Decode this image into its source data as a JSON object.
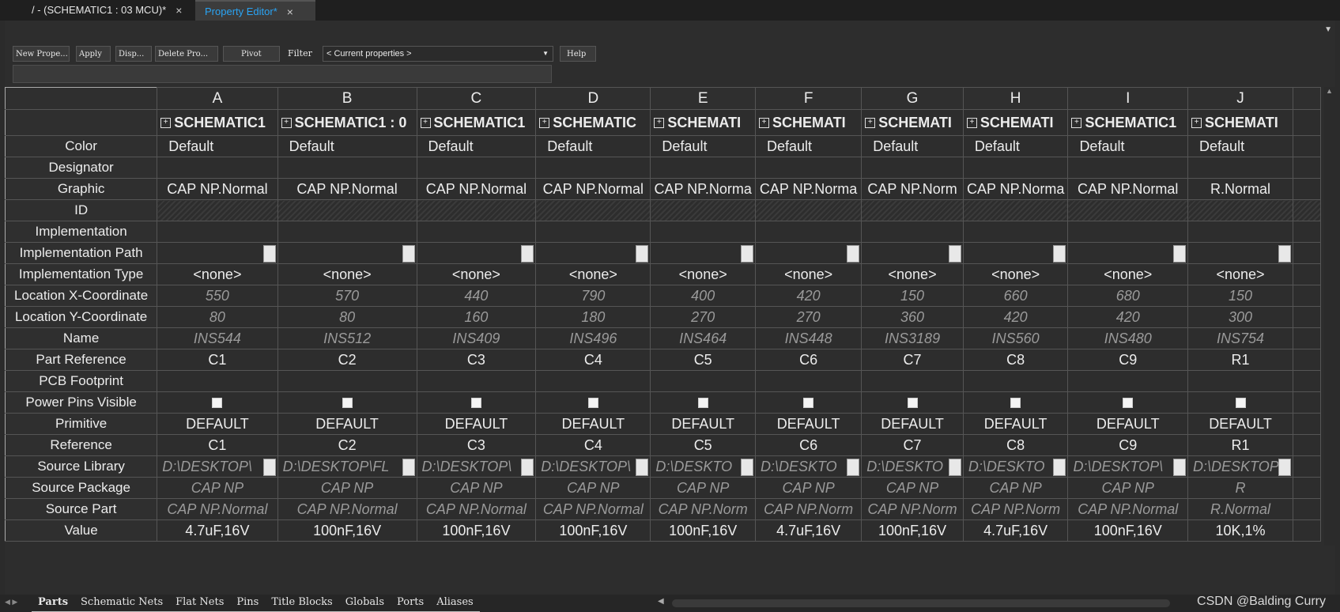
{
  "tabs": [
    {
      "label": "/ - (SCHEMATIC1 : 03 MCU)*",
      "close": "×"
    },
    {
      "label": "Property Editor*",
      "close": "×"
    }
  ],
  "panel_menu": "▼",
  "toolbar": {
    "new_property": "New Prope...",
    "apply": "Apply",
    "display": "Disp...",
    "delete_property": "Delete Pro...",
    "pivot": "Pivot",
    "filter_label": "Filter",
    "filter_value": "< Current properties >",
    "help": "Help"
  },
  "grid": {
    "columns": [
      "A",
      "B",
      "C",
      "D",
      "E",
      "F",
      "G",
      "H",
      "I",
      "J"
    ],
    "headers": [
      "SCHEMATIC1",
      "SCHEMATIC1 : 0",
      "SCHEMATIC1",
      "SCHEMATIC",
      "SCHEMATI",
      "SCHEMATI",
      "SCHEMATI",
      "SCHEMATI",
      "SCHEMATIC1",
      "SCHEMATI"
    ],
    "row_labels": {
      "color": "Color",
      "designator": "Designator",
      "graphic": "Graphic",
      "id": "ID",
      "implementation": "Implementation",
      "implementation_path": "Implementation Path",
      "implementation_type": "Implementation Type",
      "loc_x": "Location X-Coordinate",
      "loc_y": "Location Y-Coordinate",
      "name": "Name",
      "part_reference": "Part Reference",
      "pcb_footprint": "PCB Footprint",
      "power_pins_visible": "Power Pins Visible",
      "primitive": "Primitive",
      "reference": "Reference",
      "source_library": "Source Library",
      "source_package": "Source Package",
      "source_part": "Source Part",
      "value": "Value"
    },
    "color": [
      "Default",
      "Default",
      "Default",
      "Default",
      "Default",
      "Default",
      "Default",
      "Default",
      "Default",
      "Default"
    ],
    "graphic": [
      "CAP NP.Normal",
      "CAP NP.Normal",
      "CAP NP.Normal",
      "CAP NP.Normal",
      "CAP NP.Norma",
      "CAP NP.Norma",
      "CAP NP.Norm",
      "CAP NP.Norma",
      "CAP NP.Normal",
      "R.Normal"
    ],
    "implementation_type": [
      "<none>",
      "<none>",
      "<none>",
      "<none>",
      "<none>",
      "<none>",
      "<none>",
      "<none>",
      "<none>",
      "<none>"
    ],
    "loc_x": [
      "550",
      "570",
      "440",
      "790",
      "400",
      "420",
      "150",
      "660",
      "680",
      "150"
    ],
    "loc_y": [
      "80",
      "80",
      "160",
      "180",
      "270",
      "270",
      "360",
      "420",
      "420",
      "300"
    ],
    "name": [
      "INS544",
      "INS512",
      "INS409",
      "INS496",
      "INS464",
      "INS448",
      "INS3189",
      "INS560",
      "INS480",
      "INS754"
    ],
    "part_reference": [
      "C1",
      "C2",
      "C3",
      "C4",
      "C5",
      "C6",
      "C7",
      "C8",
      "C9",
      "R1"
    ],
    "primitive": [
      "DEFAULT",
      "DEFAULT",
      "DEFAULT",
      "DEFAULT",
      "DEFAULT",
      "DEFAULT",
      "DEFAULT",
      "DEFAULT",
      "DEFAULT",
      "DEFAULT"
    ],
    "reference": [
      "C1",
      "C2",
      "C3",
      "C4",
      "C5",
      "C6",
      "C7",
      "C8",
      "C9",
      "R1"
    ],
    "source_library": [
      "D:\\DESKTOP\\",
      "D:\\DESKTOP\\FL",
      "D:\\DESKTOP\\",
      "D:\\DESKTOP\\",
      "D:\\DESKTO",
      "D:\\DESKTO",
      "D:\\DESKTO",
      "D:\\DESKTO",
      "D:\\DESKTOP\\",
      "D:\\DESKTOP"
    ],
    "source_package": [
      "CAP NP",
      "CAP NP",
      "CAP NP",
      "CAP NP",
      "CAP NP",
      "CAP NP",
      "CAP NP",
      "CAP NP",
      "CAP NP",
      "R"
    ],
    "source_part": [
      "CAP NP.Normal",
      "CAP NP.Normal",
      "CAP NP.Normal",
      "CAP NP.Normal",
      "CAP NP.Norm",
      "CAP NP.Norm",
      "CAP NP.Norm",
      "CAP NP.Norm",
      "CAP NP.Normal",
      "R.Normal"
    ],
    "value": [
      "4.7uF,16V",
      "100nF,16V",
      "100nF,16V",
      "100nF,16V",
      "100nF,16V",
      "4.7uF,16V",
      "100nF,16V",
      "4.7uF,16V",
      "100nF,16V",
      "10K,1%"
    ]
  },
  "sheet_tabs": [
    "Parts",
    "Schematic Nets",
    "Flat Nets",
    "Pins",
    "Title Blocks",
    "Globals",
    "Ports",
    "Aliases"
  ],
  "watermark": "CSDN @Balding Curry",
  "colors": {
    "active_tab_text": "#2aa4f4",
    "background": "#2b2b2b"
  }
}
